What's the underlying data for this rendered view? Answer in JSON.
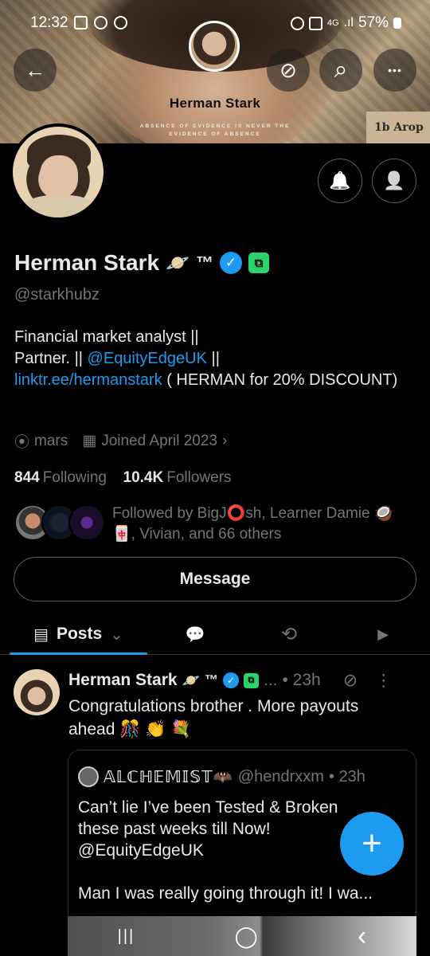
{
  "status_bar": {
    "time": "12:32",
    "battery": "57%",
    "network": "4G"
  },
  "banner": {
    "title": "Herman Stark",
    "subtitle_line1": "ABSENCE OF EVIDENCE IS NEVER THE",
    "subtitle_line2": "EVIDENCE OF ABSENCE",
    "paper_text": "1b Arop"
  },
  "nav": {
    "back_icon": "←",
    "search_icon": "⌕",
    "more_icon": "•••",
    "grok_icon": "⊘"
  },
  "profile": {
    "display_name": "Herman Stark",
    "name_emoji": "🪐",
    "trademark": "™",
    "verified_mark": "✓",
    "green_badge": "⧉",
    "handle": "@starkhubz",
    "bio_line1": "Financial market analyst ||",
    "bio_line2_prefix": "Partner. || ",
    "bio_mention": "@EquityEdgeUK",
    "bio_line2_suffix": " ||",
    "bio_link": "linktr.ee/hermanstark",
    "bio_after_link": " ( HERMAN for 20% DISCOUNT)",
    "location": "mars",
    "joined": "Joined April 2023",
    "following_count": "844",
    "following_label": "Following",
    "followers_count": "10.4K",
    "followers_label": "Followers",
    "followed_by": "Followed by BigJ⭕sh, Learner Damie 🥥 🀄, Vivian, and 66 others"
  },
  "buttons": {
    "notify_icon": "🔔",
    "follow_icon": "👤",
    "message": "Message"
  },
  "tabs": {
    "posts": "Posts",
    "posts_chevron": "⌄",
    "replies_icon": "💬",
    "reposts_icon": "⟲",
    "media_icon": "▶"
  },
  "post": {
    "author": "Herman Stark",
    "author_emoji": "🪐",
    "trademark": "™",
    "ellipsis": "...",
    "time": "• 23h",
    "menu": "⋮",
    "text_line1": "Congratulations  brother  . More payouts",
    "text_line2": "ahead 🎊 👏 💐",
    "quote": {
      "author": "𝔸𝕃ℂℍ𝔼𝕄𝕀𝕊𝕋🦇",
      "handle": "@hendrxxm",
      "time": "• 23h",
      "text_line1": "Can’t lie I’ve been Tested & Broken",
      "text_line2": "these past weeks till Now!",
      "text_line3": "@EquityEdgeUK",
      "text_line5": "Man I was really going through it! I wa..."
    }
  },
  "fab": {
    "icon": "+"
  },
  "android_nav": {
    "recent": "|||",
    "home": "◯",
    "back": "‹"
  }
}
